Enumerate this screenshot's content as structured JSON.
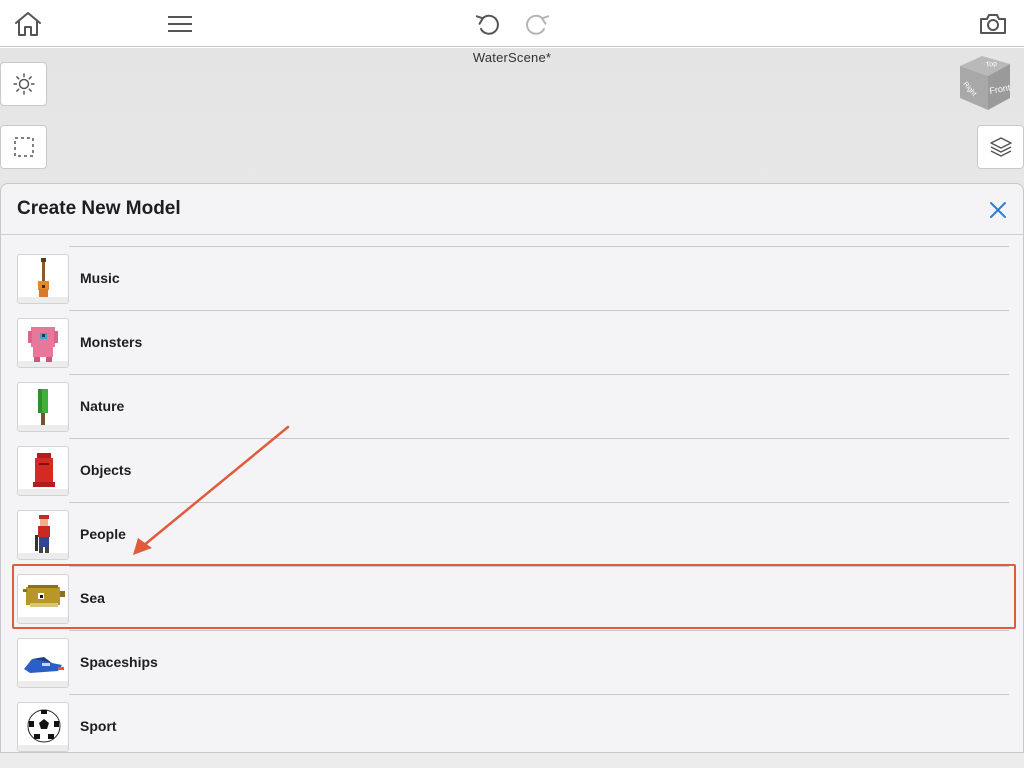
{
  "toolbar": {
    "home": "home-icon",
    "menu": "hamburger-menu-icon",
    "undo": "undo-icon",
    "redo": "redo-icon",
    "camera": "camera-icon"
  },
  "scene": {
    "title": "WaterScene*"
  },
  "view_cube": {
    "top": "Top",
    "front": "Front",
    "right": "Right"
  },
  "panel": {
    "title": "Create New Model",
    "close": "close-icon",
    "items": [
      {
        "label": "Music",
        "icon": "ukulele-icon"
      },
      {
        "label": "Monsters",
        "icon": "monster-icon"
      },
      {
        "label": "Nature",
        "icon": "tree-icon"
      },
      {
        "label": "Objects",
        "icon": "postbox-icon"
      },
      {
        "label": "People",
        "icon": "person-icon"
      },
      {
        "label": "Sea",
        "icon": "pufferfish-icon"
      },
      {
        "label": "Spaceships",
        "icon": "spaceship-icon"
      },
      {
        "label": "Sport",
        "icon": "soccer-ball-icon"
      }
    ]
  },
  "annotation": {
    "color": "#e05b3c",
    "highlighted_item": "Sea"
  },
  "colors": {
    "accent": "#2f7fd1",
    "annotation": "#e05b3c"
  }
}
